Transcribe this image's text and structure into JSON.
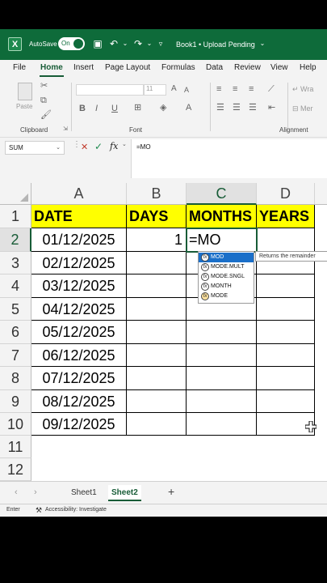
{
  "titlebar": {
    "autosave_label": "AutoSave",
    "autosave_state": "On",
    "doc_title": "Book1 • Upload Pending"
  },
  "menu": [
    "File",
    "Home",
    "Insert",
    "Page Layout",
    "Formulas",
    "Data",
    "Review",
    "View",
    "Help"
  ],
  "ribbon": {
    "paste_label": "Paste",
    "font_name": "",
    "font_size": "11",
    "wrap_label": "Wra",
    "merge_label": "Mer",
    "groups": [
      "Clipboard",
      "Font",
      "Alignment"
    ]
  },
  "formula_bar": {
    "name_box": "SUM",
    "fx": "fx",
    "formula": "=MO"
  },
  "grid": {
    "columns": [
      "A",
      "B",
      "C",
      "D"
    ],
    "rows": [
      "1",
      "2",
      "3",
      "4",
      "5",
      "6",
      "7",
      "8",
      "9",
      "10",
      "11",
      "12"
    ],
    "headers": [
      "DATE",
      "DAYS",
      "MONTHS",
      "YEARS"
    ],
    "dates": [
      "01/12/2025",
      "02/12/2025",
      "03/12/2025",
      "04/12/2025",
      "05/12/2025",
      "06/12/2025",
      "07/12/2025",
      "08/12/2025",
      "09/12/2025"
    ],
    "b2": "1",
    "c2_editing": "=MO"
  },
  "autocomplete": {
    "items": [
      "MOD",
      "MODE.MULT",
      "MODE.SNGL",
      "MONTH",
      "MODE"
    ],
    "tooltip": "Returns the remainder"
  },
  "sheets": {
    "tabs": [
      "Sheet1",
      "Sheet2"
    ],
    "active": "Sheet2"
  },
  "status": {
    "mode": "Enter",
    "accessibility": "Accessibility: Investigate"
  },
  "colors": {
    "brand": "#0e6b3a",
    "header_fill": "#ffff00",
    "selection": "#1a6fc9"
  }
}
